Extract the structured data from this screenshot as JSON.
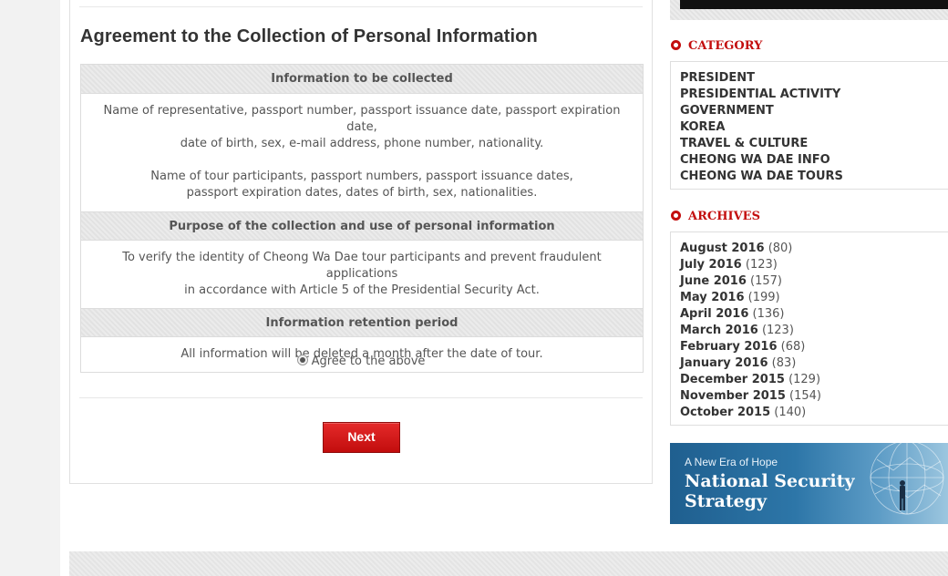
{
  "main": {
    "title": "Agreement to the Collection of Personal Information",
    "sections": [
      {
        "header": "Information to be collected",
        "paragraphs": [
          [
            "Name of representative, passport number, passport issuance date, passport expiration date,",
            "date of birth, sex, e-mail address, phone number, nationality."
          ],
          [
            "Name of tour participants, passport numbers, passport issuance dates,",
            "passport expiration dates, dates of birth, sex, nationalities."
          ]
        ]
      },
      {
        "header": "Purpose of the collection and use of personal information",
        "paragraphs": [
          [
            "To verify the identity of Cheong Wa Dae tour participants and prevent fraudulent applications",
            "in accordance with Article 5 of the Presidential Security Act."
          ]
        ]
      },
      {
        "header": "Information retention period",
        "paragraphs": [
          [
            "All information will be deleted a month after the date of tour."
          ]
        ]
      }
    ],
    "agree_label": "Agree to the above",
    "agree_checked": true,
    "next_label": "Next"
  },
  "sidebar": {
    "category_title": "CATEGORY",
    "categories": [
      "PRESIDENT",
      "PRESIDENTIAL ACTIVITY",
      "GOVERNMENT",
      "KOREA",
      "TRAVEL & CULTURE",
      "CHEONG WA DAE INFO",
      "CHEONG WA DAE TOURS"
    ],
    "archives_title": "ARCHIVES",
    "archives": [
      {
        "month": "August 2016",
        "count": "(80)"
      },
      {
        "month": "July 2016",
        "count": "(123)"
      },
      {
        "month": "June 2016",
        "count": "(157)"
      },
      {
        "month": "May 2016",
        "count": "(199)"
      },
      {
        "month": "April 2016",
        "count": "(136)"
      },
      {
        "month": "March 2016",
        "count": "(123)"
      },
      {
        "month": "February 2016",
        "count": "(68)"
      },
      {
        "month": "January 2016",
        "count": "(83)"
      },
      {
        "month": "December 2015",
        "count": "(129)"
      },
      {
        "month": "November 2015",
        "count": "(154)"
      },
      {
        "month": "October 2015",
        "count": "(140)"
      }
    ],
    "banner": {
      "subtitle": "A New Era of Hope",
      "title_line1": "National Security",
      "title_line2": "Strategy"
    }
  },
  "colors": {
    "accent_red": "#c30d0d",
    "button_red": "#d41a1a",
    "banner_blue": "#2d76a8"
  },
  "icons": {
    "section_bullet": "red-ring-bullet-icon",
    "radio": "radio-selected-icon"
  }
}
